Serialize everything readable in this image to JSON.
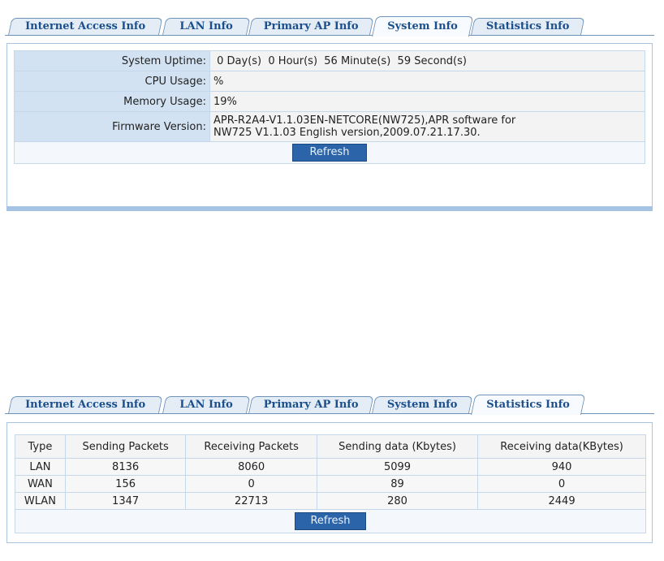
{
  "tabs": [
    {
      "label": "Internet Access Info"
    },
    {
      "label": "LAN Info"
    },
    {
      "label": "Primary AP Info"
    },
    {
      "label": "System Info"
    },
    {
      "label": "Statistics Info"
    }
  ],
  "system": {
    "rows": [
      {
        "label": "System Uptime:",
        "value": " 0 Day(s)  0 Hour(s)  56 Minute(s)  59 Second(s)"
      },
      {
        "label": "CPU Usage:",
        "value": "%"
      },
      {
        "label": "Memory Usage:",
        "value": "19%"
      },
      {
        "label": "Firmware Version:",
        "value_line1": "APR-R2A4-V1.1.03EN-NETCORE(NW725),APR software for",
        "value_line2": "NW725 V1.1.03 English version,2009.07.21.17.30."
      }
    ],
    "refresh_label": "Refresh"
  },
  "statistics": {
    "headers": [
      "Type",
      "Sending Packets",
      "Receiving Packets",
      "Sending data (Kbytes)",
      "Receiving data(KBytes)"
    ],
    "rows": [
      [
        "LAN",
        "8136",
        "8060",
        "5099",
        "940"
      ],
      [
        "WAN",
        "156",
        "0",
        "89",
        "0"
      ],
      [
        "WLAN",
        "1347",
        "22713",
        "280",
        "2449"
      ]
    ],
    "refresh_label": "Refresh"
  }
}
